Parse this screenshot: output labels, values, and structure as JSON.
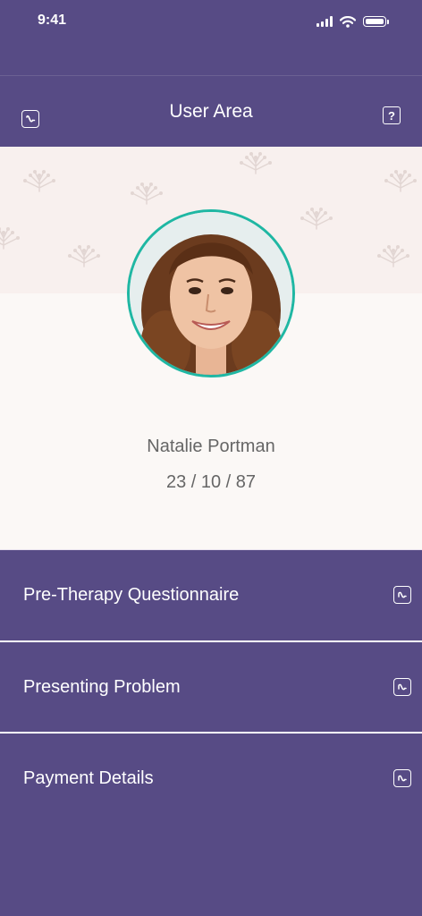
{
  "status_bar": {
    "time": "9:41"
  },
  "header": {
    "title": "User Area",
    "left_icon": "back-icon",
    "right_icon": "help-icon",
    "help_glyph": "?"
  },
  "profile": {
    "name": "Natalie Portman",
    "dob": "23 / 10 / 87",
    "avatar_icon": "user-photo"
  },
  "menu": {
    "items": [
      {
        "label": "Pre-Therapy Questionnaire",
        "icon": "open-icon"
      },
      {
        "label": "Presenting Problem",
        "icon": "open-icon"
      },
      {
        "label": "Payment Details",
        "icon": "open-icon"
      }
    ]
  },
  "colors": {
    "primary": "#574b85",
    "accent": "#1fb7a3",
    "profile_bg": "#fbf8f6",
    "pattern_bg": "#f8f0ee"
  }
}
